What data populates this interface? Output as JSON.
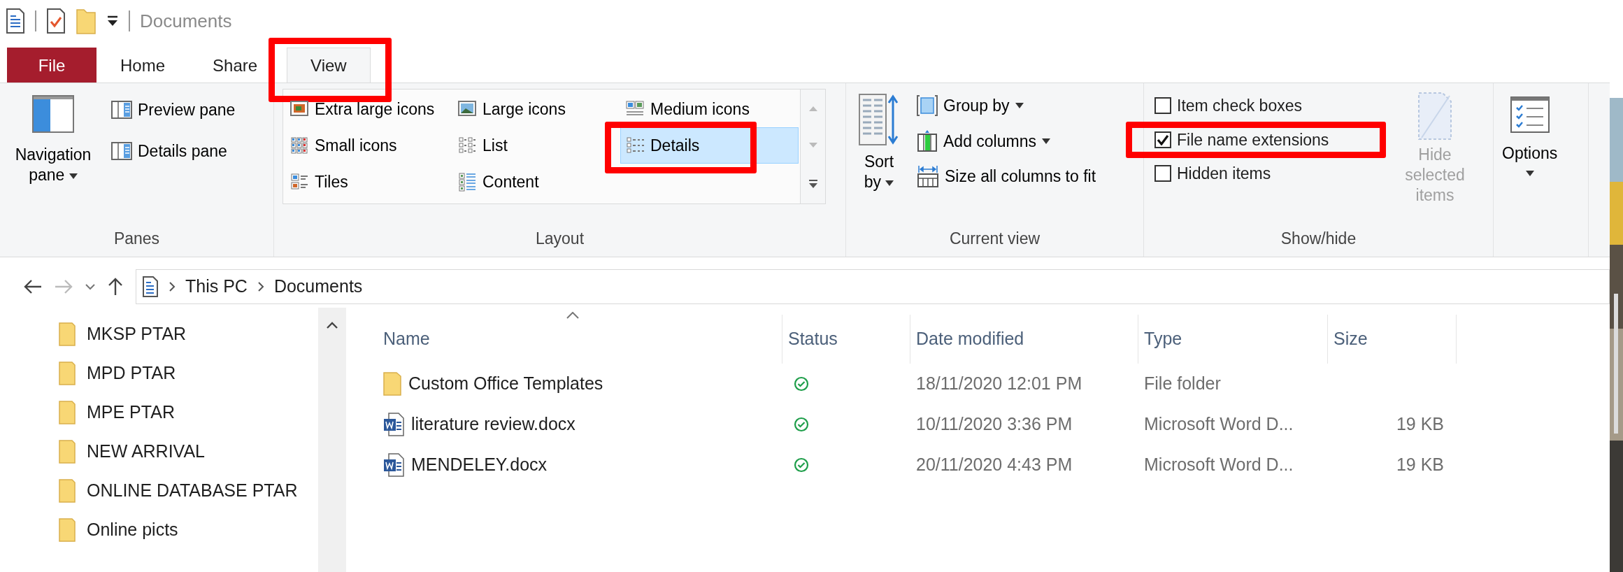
{
  "quick_access": {
    "title": "Documents"
  },
  "tabs": [
    {
      "label": "File",
      "kind": "file",
      "selected": false,
      "highlighted": false
    },
    {
      "label": "Home",
      "kind": "tab",
      "selected": false,
      "highlighted": false
    },
    {
      "label": "Share",
      "kind": "tab",
      "selected": false,
      "highlighted": false
    },
    {
      "label": "View",
      "kind": "tab",
      "selected": true,
      "highlighted": true
    }
  ],
  "panes": {
    "label": "Panes",
    "navigation_pane": "Navigation pane",
    "preview_pane": "Preview pane",
    "details_pane": "Details pane"
  },
  "layout": {
    "label": "Layout",
    "options": [
      {
        "label": "Extra large icons",
        "kind": "xlarge",
        "selected": false,
        "highlighted": false
      },
      {
        "label": "Large icons",
        "kind": "large",
        "selected": false,
        "highlighted": false
      },
      {
        "label": "Medium icons",
        "kind": "medium",
        "selected": false,
        "highlighted": false
      },
      {
        "label": "Small icons",
        "kind": "small",
        "selected": false,
        "highlighted": false
      },
      {
        "label": "List",
        "kind": "list",
        "selected": false,
        "highlighted": false
      },
      {
        "label": "Details",
        "kind": "details",
        "selected": true,
        "highlighted": true
      },
      {
        "label": "Tiles",
        "kind": "tiles",
        "selected": false,
        "highlighted": false
      },
      {
        "label": "Content",
        "kind": "content",
        "selected": false,
        "highlighted": false
      }
    ]
  },
  "current_view": {
    "label": "Current view",
    "sort_by": "Sort by",
    "group_by": "Group by",
    "add_columns": "Add columns",
    "size_columns": "Size all columns to fit"
  },
  "show_hide": {
    "label": "Show/hide",
    "checkboxes": [
      {
        "label": "Item check boxes",
        "checked": false,
        "highlighted": false
      },
      {
        "label": "File name extensions",
        "checked": true,
        "highlighted": true
      },
      {
        "label": "Hidden items",
        "checked": false,
        "highlighted": false
      }
    ],
    "hide_selected": {
      "label": "Hide selected items",
      "disabled": true
    }
  },
  "options": {
    "label": "Options"
  },
  "address": {
    "crumbs": [
      "This PC",
      "Documents"
    ]
  },
  "sidebar": {
    "items": [
      "MKSP PTAR",
      "MPD PTAR",
      "MPE PTAR",
      "NEW ARRIVAL",
      "ONLINE DATABASE PTAR",
      "Online picts"
    ]
  },
  "file_list": {
    "columns": [
      {
        "label": "Name",
        "sorted": true
      },
      {
        "label": "Status",
        "sorted": false
      },
      {
        "label": "Date modified",
        "sorted": false
      },
      {
        "label": "Type",
        "sorted": false
      },
      {
        "label": "Size",
        "sorted": false
      }
    ],
    "rows": [
      {
        "name": "Custom Office Templates",
        "kind": "folder",
        "date": "18/11/2020 12:01 PM",
        "type": "File folder",
        "size": ""
      },
      {
        "name": "literature review.docx",
        "kind": "word",
        "date": "10/11/2020 3:36 PM",
        "type": "Microsoft Word D...",
        "size": "19 KB"
      },
      {
        "name": "MENDELEY.docx",
        "kind": "word",
        "date": "20/11/2020 4:43 PM",
        "type": "Microsoft Word D...",
        "size": "19 KB"
      }
    ]
  }
}
